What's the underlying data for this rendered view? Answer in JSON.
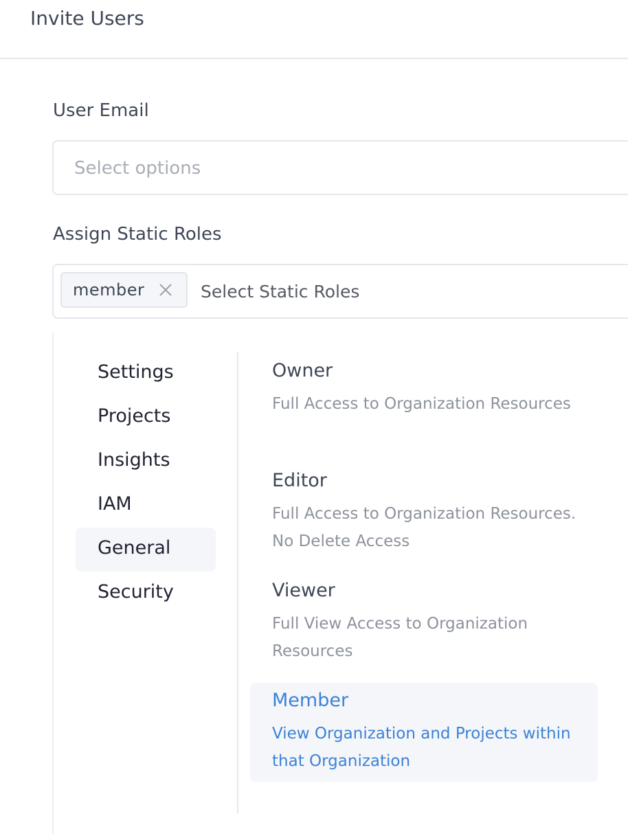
{
  "header": {
    "title": "Invite Users"
  },
  "email_field": {
    "label": "User Email",
    "placeholder": "Select options"
  },
  "roles_field": {
    "label": "Assign Static Roles",
    "placeholder": "Select Static Roles",
    "selected_chips": [
      {
        "label": "member"
      }
    ]
  },
  "dropdown": {
    "categories": [
      {
        "label": "Settings"
      },
      {
        "label": "Projects"
      },
      {
        "label": "Insights"
      },
      {
        "label": "IAM"
      },
      {
        "label": "General",
        "active": true
      },
      {
        "label": "Security"
      }
    ],
    "roles": [
      {
        "name": "Owner",
        "description": "Full Access to Organization Resources"
      },
      {
        "name": "Editor",
        "description": "Full Access to Organization Resources. No Delete Access"
      },
      {
        "name": "Viewer",
        "description": "Full View Access to Organization Resources"
      },
      {
        "name": "Member",
        "description": "View Organization and Projects within that Organization",
        "selected": true
      }
    ]
  },
  "colors": {
    "text_primary": "#3f4657",
    "placeholder": "#a9adb6",
    "border": "#e5e7eb",
    "highlight_bg": "#f5f6fa",
    "accent": "#3b82d6"
  },
  "icons": {
    "chip_remove": "close-icon"
  }
}
